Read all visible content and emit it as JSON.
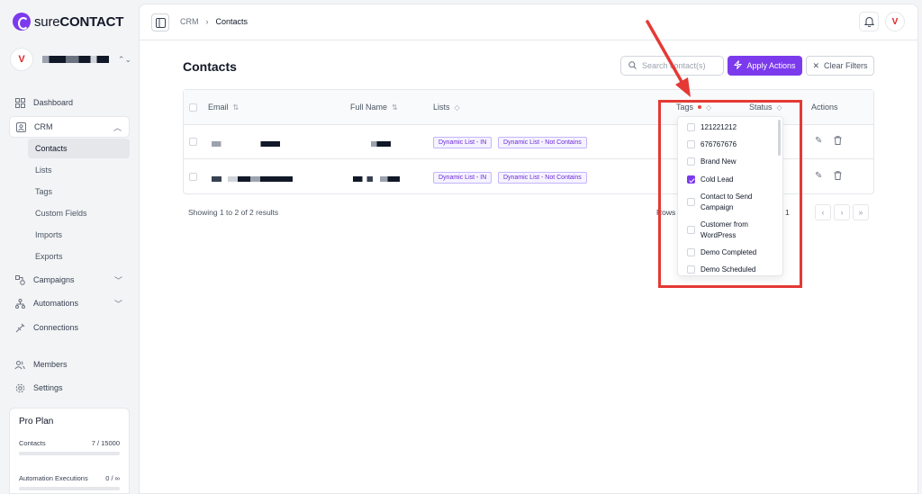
{
  "brand": {
    "light": "sure",
    "bold": "CONTACT"
  },
  "workspace": {
    "avatar": "V"
  },
  "sidebar": {
    "items": [
      {
        "label": "Dashboard",
        "icon": "dashboard-icon"
      },
      {
        "label": "CRM",
        "icon": "contacts-icon"
      },
      {
        "label": "Campaigns",
        "icon": "campaigns-icon"
      },
      {
        "label": "Automations",
        "icon": "automations-icon"
      },
      {
        "label": "Connections",
        "icon": "connections-icon"
      },
      {
        "label": "Members",
        "icon": "members-icon"
      },
      {
        "label": "Settings",
        "icon": "settings-icon"
      }
    ],
    "crm_sub": [
      "Contacts",
      "Lists",
      "Tags",
      "Custom Fields",
      "Imports",
      "Exports"
    ]
  },
  "plan": {
    "title": "Pro Plan",
    "contacts_label": "Contacts",
    "contacts_value": "7 / 15000",
    "contacts_fraction": 0.0005,
    "automation_label": "Automation Executions",
    "automation_value": "0 / ∞"
  },
  "header": {
    "breadcrumb": [
      "CRM",
      "Contacts"
    ],
    "avatar": "V"
  },
  "page": {
    "title": "Contacts",
    "search_placeholder": "Search contact(s)",
    "apply_label": "Apply Actions",
    "clear_label": "Clear Filters"
  },
  "table": {
    "columns": [
      "Email",
      "Full Name",
      "Lists",
      "Tags",
      "Status",
      "Actions"
    ],
    "rows": [
      {
        "lists": [
          "Dynamic List - IN",
          "Dynamic List - Not Contains"
        ]
      },
      {
        "lists": [
          "Dynamic List - IN",
          "Dynamic List - Not Contains"
        ]
      }
    ],
    "results_text": "Showing 1 to 2 of 2 results",
    "rows_label": "Rows",
    "page_number": "1"
  },
  "tags_dropdown": {
    "options": [
      {
        "label": "121221212",
        "checked": false
      },
      {
        "label": "676767676",
        "checked": false
      },
      {
        "label": "Brand New",
        "checked": false
      },
      {
        "label": "Cold Lead",
        "checked": true
      },
      {
        "label": "Contact to Send Campaign",
        "checked": false
      },
      {
        "label": "Customer from WordPress",
        "checked": false
      },
      {
        "label": "Demo Completed",
        "checked": false
      },
      {
        "label": "Demo Scheduled",
        "checked": false
      }
    ]
  },
  "colors": {
    "accent": "#7c3aed",
    "annotation": "#e53935",
    "filter_dot": "#ef4444"
  }
}
